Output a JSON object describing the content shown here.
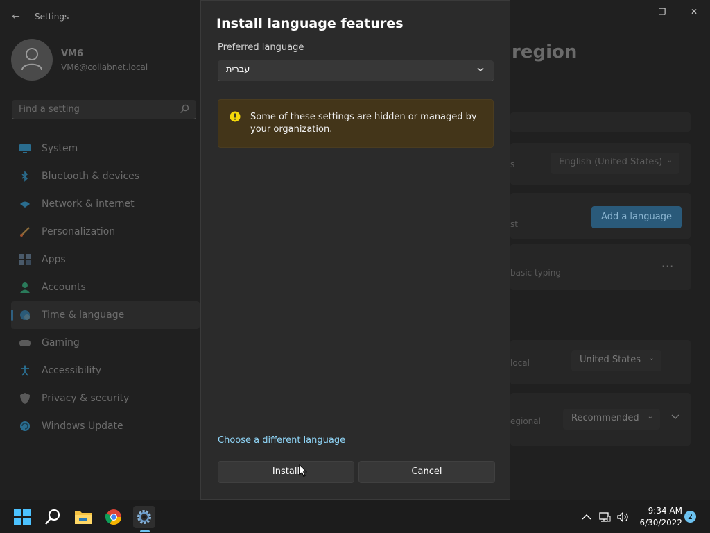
{
  "window": {
    "app_title": "Settings",
    "back_glyph": "←",
    "minimize_glyph": "—",
    "maximize_glyph": "❐",
    "close_glyph": "✕"
  },
  "profile": {
    "name": "VM6",
    "email": "VM6@collabnet.local"
  },
  "search": {
    "placeholder": "Find a setting"
  },
  "sidebar": {
    "items": [
      {
        "label": "System",
        "icon": "monitor-icon",
        "active": false
      },
      {
        "label": "Bluetooth & devices",
        "icon": "bluetooth-icon",
        "active": false
      },
      {
        "label": "Network & internet",
        "icon": "wifi-icon",
        "active": false
      },
      {
        "label": "Personalization",
        "icon": "brush-icon",
        "active": false
      },
      {
        "label": "Apps",
        "icon": "apps-icon",
        "active": false
      },
      {
        "label": "Accounts",
        "icon": "person-icon",
        "active": false
      },
      {
        "label": "Time & language",
        "icon": "globe-clock-icon",
        "active": true
      },
      {
        "label": "Gaming",
        "icon": "gamepad-icon",
        "active": false
      },
      {
        "label": "Accessibility",
        "icon": "accessibility-icon",
        "active": false
      },
      {
        "label": "Privacy & security",
        "icon": "shield-icon",
        "active": false
      },
      {
        "label": "Windows Update",
        "icon": "update-icon",
        "active": false
      }
    ]
  },
  "content": {
    "title_fragment": "region",
    "display_language_value": "English (United States)",
    "row_fragment_s": "s",
    "row_fragment_st": "st",
    "add_language_label": "Add a language",
    "basic_typing": "basic typing",
    "more_glyph": "···",
    "region_fragment": "local",
    "country_value": "United States",
    "regional_fragment": "egional",
    "format_value": "Recommended"
  },
  "dialog": {
    "title": "Install language features",
    "preferred_label": "Preferred language",
    "selected_language": "עברית",
    "warning": "Some of these settings are hidden or managed by your organization.",
    "link": "Choose a different language",
    "install_label": "Install",
    "cancel_label": "Cancel"
  },
  "taskbar": {
    "time": "9:34 AM",
    "date": "6/30/2022",
    "notification_count": "2"
  },
  "colors": {
    "accent": "#6cc2f0",
    "link": "#8fd4f6",
    "warning_bg": "#433519",
    "warning_icon": "#f5d90a"
  }
}
